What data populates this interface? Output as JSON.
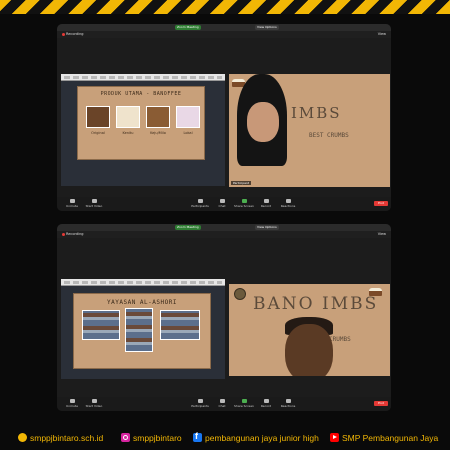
{
  "meeting": {
    "meeting_title": "Zoom Meeting",
    "view_label": "View Options",
    "recording_label": "Recording",
    "view_corner_label": "View"
  },
  "screen1": {
    "slide_title": "PRODUK UTAMA - BANOFFEE",
    "products": [
      {
        "caption": "Original"
      },
      {
        "caption": "Kenitu"
      },
      {
        "caption": "Keju/Milo"
      },
      {
        "caption": "Lokal"
      }
    ],
    "camera": {
      "brand_word": "IMBS",
      "subtitle": "BEST CRUMBS",
      "name_tag": "Participant"
    }
  },
  "screen2": {
    "slide_title": "YAYASAN AL-ASHORI",
    "camera": {
      "brand_word": "BANO IMBS",
      "subtitle": "BEST CRUMBS"
    }
  },
  "controls": [
    "Unmute",
    "Start Video",
    "Participants",
    "Chat",
    "Share Screen",
    "Record",
    "Reactions"
  ],
  "controls_end": "End",
  "footer": {
    "website": "smppjbintaro.sch.id",
    "instagram": "smppjbintaro",
    "facebook": "pembangunan jaya junior high",
    "youtube": "SMP Pembangunan Jaya"
  },
  "colors": {
    "hazard_yellow": "#f2b705",
    "slide_beige": "#c8a07a",
    "zoom_dark": "#1c1c1c",
    "record_red": "#e53935",
    "share_green": "#4caf50"
  }
}
